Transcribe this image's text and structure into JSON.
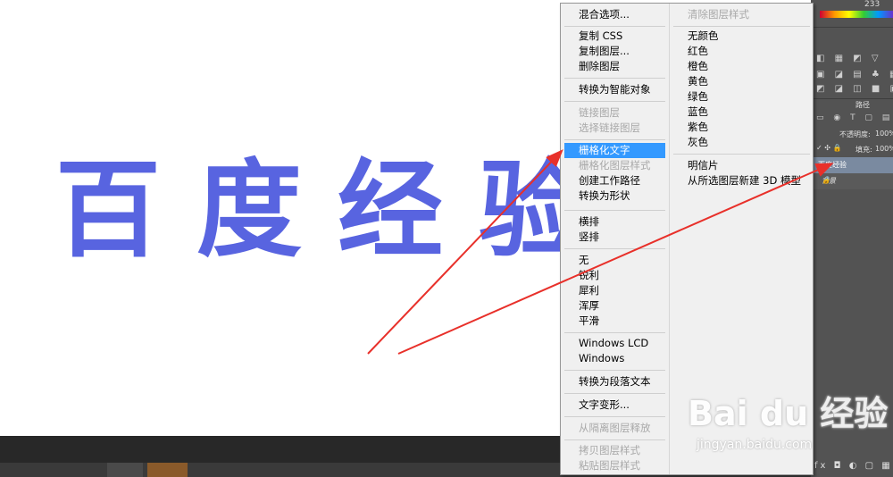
{
  "canvas": {
    "text": "百度经验",
    "text_color": "#5864e0"
  },
  "context_menu": {
    "left_column": [
      {
        "label": "混合选项...",
        "state": "normal"
      },
      {
        "label": "复制 CSS",
        "state": "normal"
      },
      {
        "label": "复制图层...",
        "state": "normal"
      },
      {
        "label": "删除图层",
        "state": "normal"
      },
      {
        "label": "转换为智能对象",
        "state": "normal"
      },
      {
        "label": "链接图层",
        "state": "disabled"
      },
      {
        "label": "选择链接图层",
        "state": "disabled"
      },
      {
        "label": "栅格化文字",
        "state": "highlighted"
      },
      {
        "label": "栅格化图层样式",
        "state": "disabled"
      },
      {
        "label": "创建工作路径",
        "state": "normal"
      },
      {
        "label": "转换为形状",
        "state": "normal"
      },
      {
        "label": "横排",
        "state": "normal"
      },
      {
        "label": "竖排",
        "state": "normal"
      },
      {
        "label": "无",
        "state": "normal"
      },
      {
        "label": "锐利",
        "state": "normal"
      },
      {
        "label": "犀利",
        "state": "normal"
      },
      {
        "label": "浑厚",
        "state": "normal"
      },
      {
        "label": "平滑",
        "state": "normal"
      },
      {
        "label": "Windows LCD",
        "state": "normal"
      },
      {
        "label": "Windows",
        "state": "normal"
      },
      {
        "label": "转换为段落文本",
        "state": "normal"
      },
      {
        "label": "文字变形...",
        "state": "normal"
      },
      {
        "label": "从隔离图层释放",
        "state": "disabled"
      },
      {
        "label": "拷贝图层样式",
        "state": "disabled"
      },
      {
        "label": "粘贴图层样式",
        "state": "disabled"
      }
    ],
    "right_column": [
      {
        "label": "清除图层样式",
        "state": "disabled"
      },
      {
        "label": "无颜色",
        "state": "normal"
      },
      {
        "label": "红色",
        "state": "normal"
      },
      {
        "label": "橙色",
        "state": "normal"
      },
      {
        "label": "黄色",
        "state": "normal"
      },
      {
        "label": "绿色",
        "state": "normal"
      },
      {
        "label": "蓝色",
        "state": "normal"
      },
      {
        "label": "紫色",
        "state": "normal"
      },
      {
        "label": "灰色",
        "state": "normal"
      },
      {
        "label": "明信片",
        "state": "normal"
      },
      {
        "label": "从所选图层新建 3D 模型",
        "state": "normal"
      }
    ]
  },
  "layers_panel": {
    "top_value": "233",
    "tab_label": "路径",
    "opacity_label": "不透明度:",
    "opacity_value": "100%",
    "fill_label": "填充:",
    "fill_value": "100%",
    "layers": [
      "百度经验",
      "背景"
    ]
  },
  "watermark": {
    "main": "Bai du 经验",
    "sub": "jingyan.baidu.com"
  },
  "colors": {
    "highlight": "#3399ff",
    "arrow": "#e8302a",
    "panel_bg": "#535353"
  }
}
